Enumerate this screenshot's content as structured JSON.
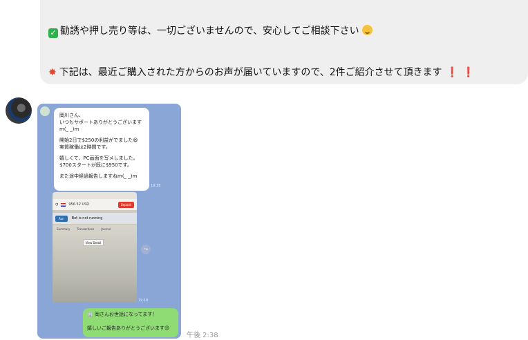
{
  "top_message": {
    "line1": "勧誘や押し売り等は、一切ございませんので、安心してご相談下さい",
    "line2": "下記は、最近ご購入された方からのお声が届いていますので、2件ご紹介させて頂きます",
    "line1_icon": "check-mark-icon",
    "line1_trail_icon": "smile-icon",
    "line2_icon": "collision-icon",
    "excl": "❗"
  },
  "image_message": {
    "white_bubble": [
      "岡川さん、\nいつもサポートありがとうございます m(_ _)m",
      "開始2日で$250の利益がでました😆\n実質稼働は2時間です。",
      "嬉しくて、PC画面を写メしました。\n$700スタートが既に$950です。",
      "また途中経過報告しますねm(_ _)m"
    ],
    "time_a": "19:38",
    "time_b": "19:16",
    "phone": {
      "balance": "956.52 USD",
      "deposit": "Deposit",
      "run": "Run",
      "status": "Bot is not running",
      "tabs": [
        "Summary",
        "Transactions",
        "Journal"
      ],
      "popup": "View Detail"
    },
    "green_bubble": "🏢 岡さんお世話になってます！\n\n嬉しいご報告ありがとうございます😊"
  },
  "timestamp": "午後 2:38"
}
